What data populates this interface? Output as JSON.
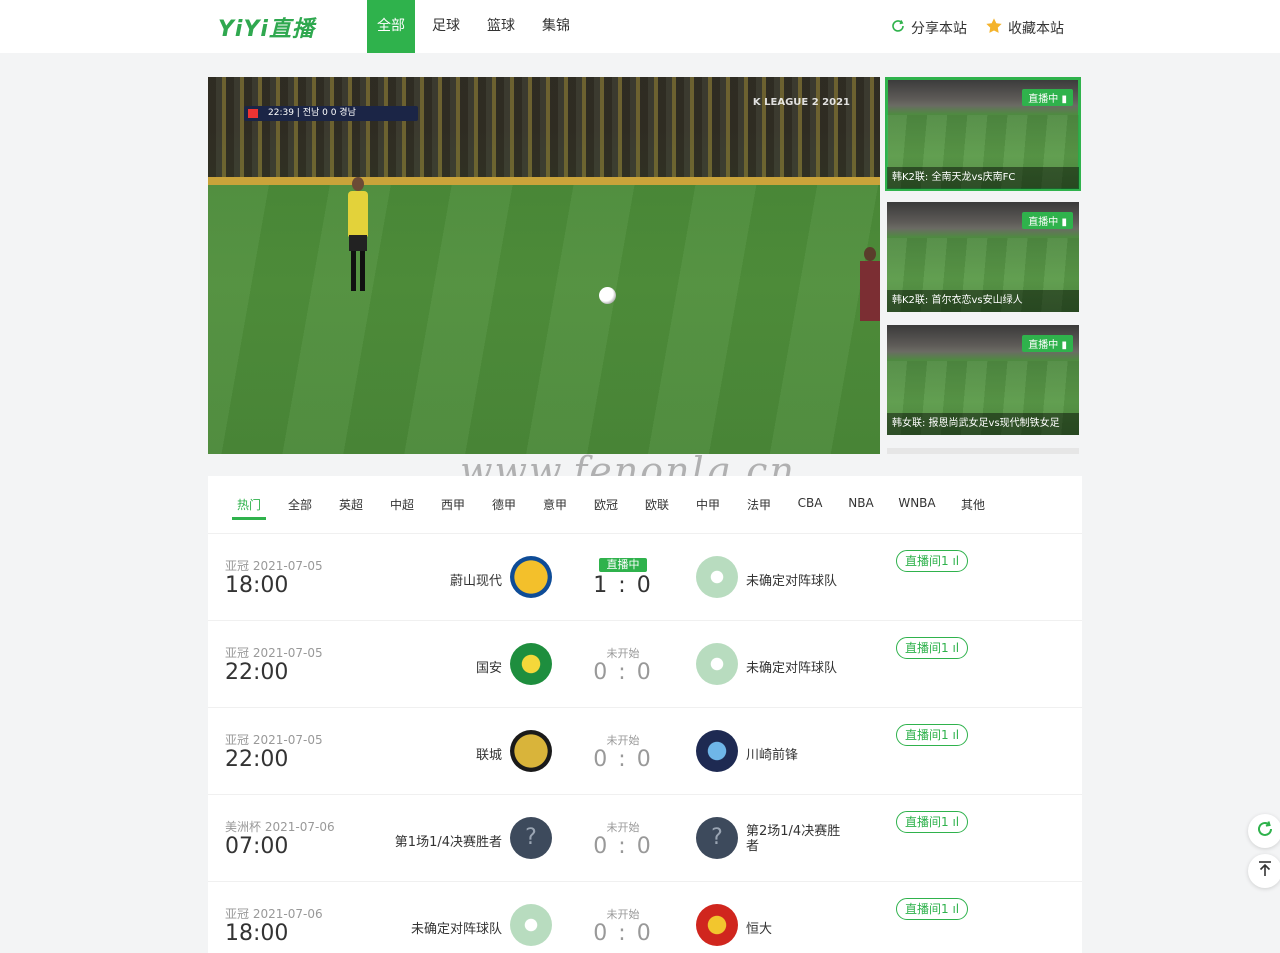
{
  "header": {
    "logo": "YiYi直播",
    "nav": [
      "全部",
      "足球",
      "篮球",
      "集锦"
    ],
    "share": "分享本站",
    "favorite": "收藏本站"
  },
  "video": {
    "scorebug": "22:39 | 전남  0  0  경남",
    "broadcast": "K LEAGUE 2 2021"
  },
  "side_list": [
    {
      "tag": "直播中",
      "title": "韩K2联: 全南天龙vs庆南FC"
    },
    {
      "tag": "直播中",
      "title": "韩K2联: 首尔衣恋vs安山绿人"
    },
    {
      "tag": "直播中",
      "title": "韩女联: 报恩尚武女足vs现代制铁女足"
    }
  ],
  "watermark": "www.fenonlg.cn",
  "tabs": [
    "热门",
    "全部",
    "英超",
    "中超",
    "西甲",
    "德甲",
    "意甲",
    "欧冠",
    "欧联",
    "中甲",
    "法甲",
    "CBA",
    "NBA",
    "WNBA",
    "其他"
  ],
  "matches": [
    {
      "league": "亚冠",
      "date": "2021-07-05",
      "time": "18:00",
      "home": "蔚山现代",
      "status": "直播中",
      "score": "1 : 0",
      "away": "未确定对阵球队",
      "room": "直播间1"
    },
    {
      "league": "亚冠",
      "date": "2021-07-05",
      "time": "22:00",
      "home": "国安",
      "status": "未开始",
      "score": "0 : 0",
      "away": "未确定对阵球队",
      "room": "直播间1"
    },
    {
      "league": "亚冠",
      "date": "2021-07-05",
      "time": "22:00",
      "home": "联城",
      "status": "未开始",
      "score": "0 : 0",
      "away": "川崎前锋",
      "room": "直播间1"
    },
    {
      "league": "美洲杯",
      "date": "2021-07-06",
      "time": "07:00",
      "home": "第1场1/4决赛胜者",
      "status": "未开始",
      "score": "0 : 0",
      "away": "第2场1/4决赛胜者",
      "room": "直播间1"
    },
    {
      "league": "亚冠",
      "date": "2021-07-06",
      "time": "18:00",
      "home": "未确定对阵球队",
      "status": "未开始",
      "score": "0 : 0",
      "away": "恒大",
      "room": "直播间1"
    }
  ],
  "colors": {
    "accent": "#2fb24c"
  },
  "icons": {
    "share": "refresh-icon",
    "favorite": "star-icon",
    "live": "signal-bars-icon",
    "refresh": "refresh-icon",
    "top": "back-to-top-icon"
  }
}
